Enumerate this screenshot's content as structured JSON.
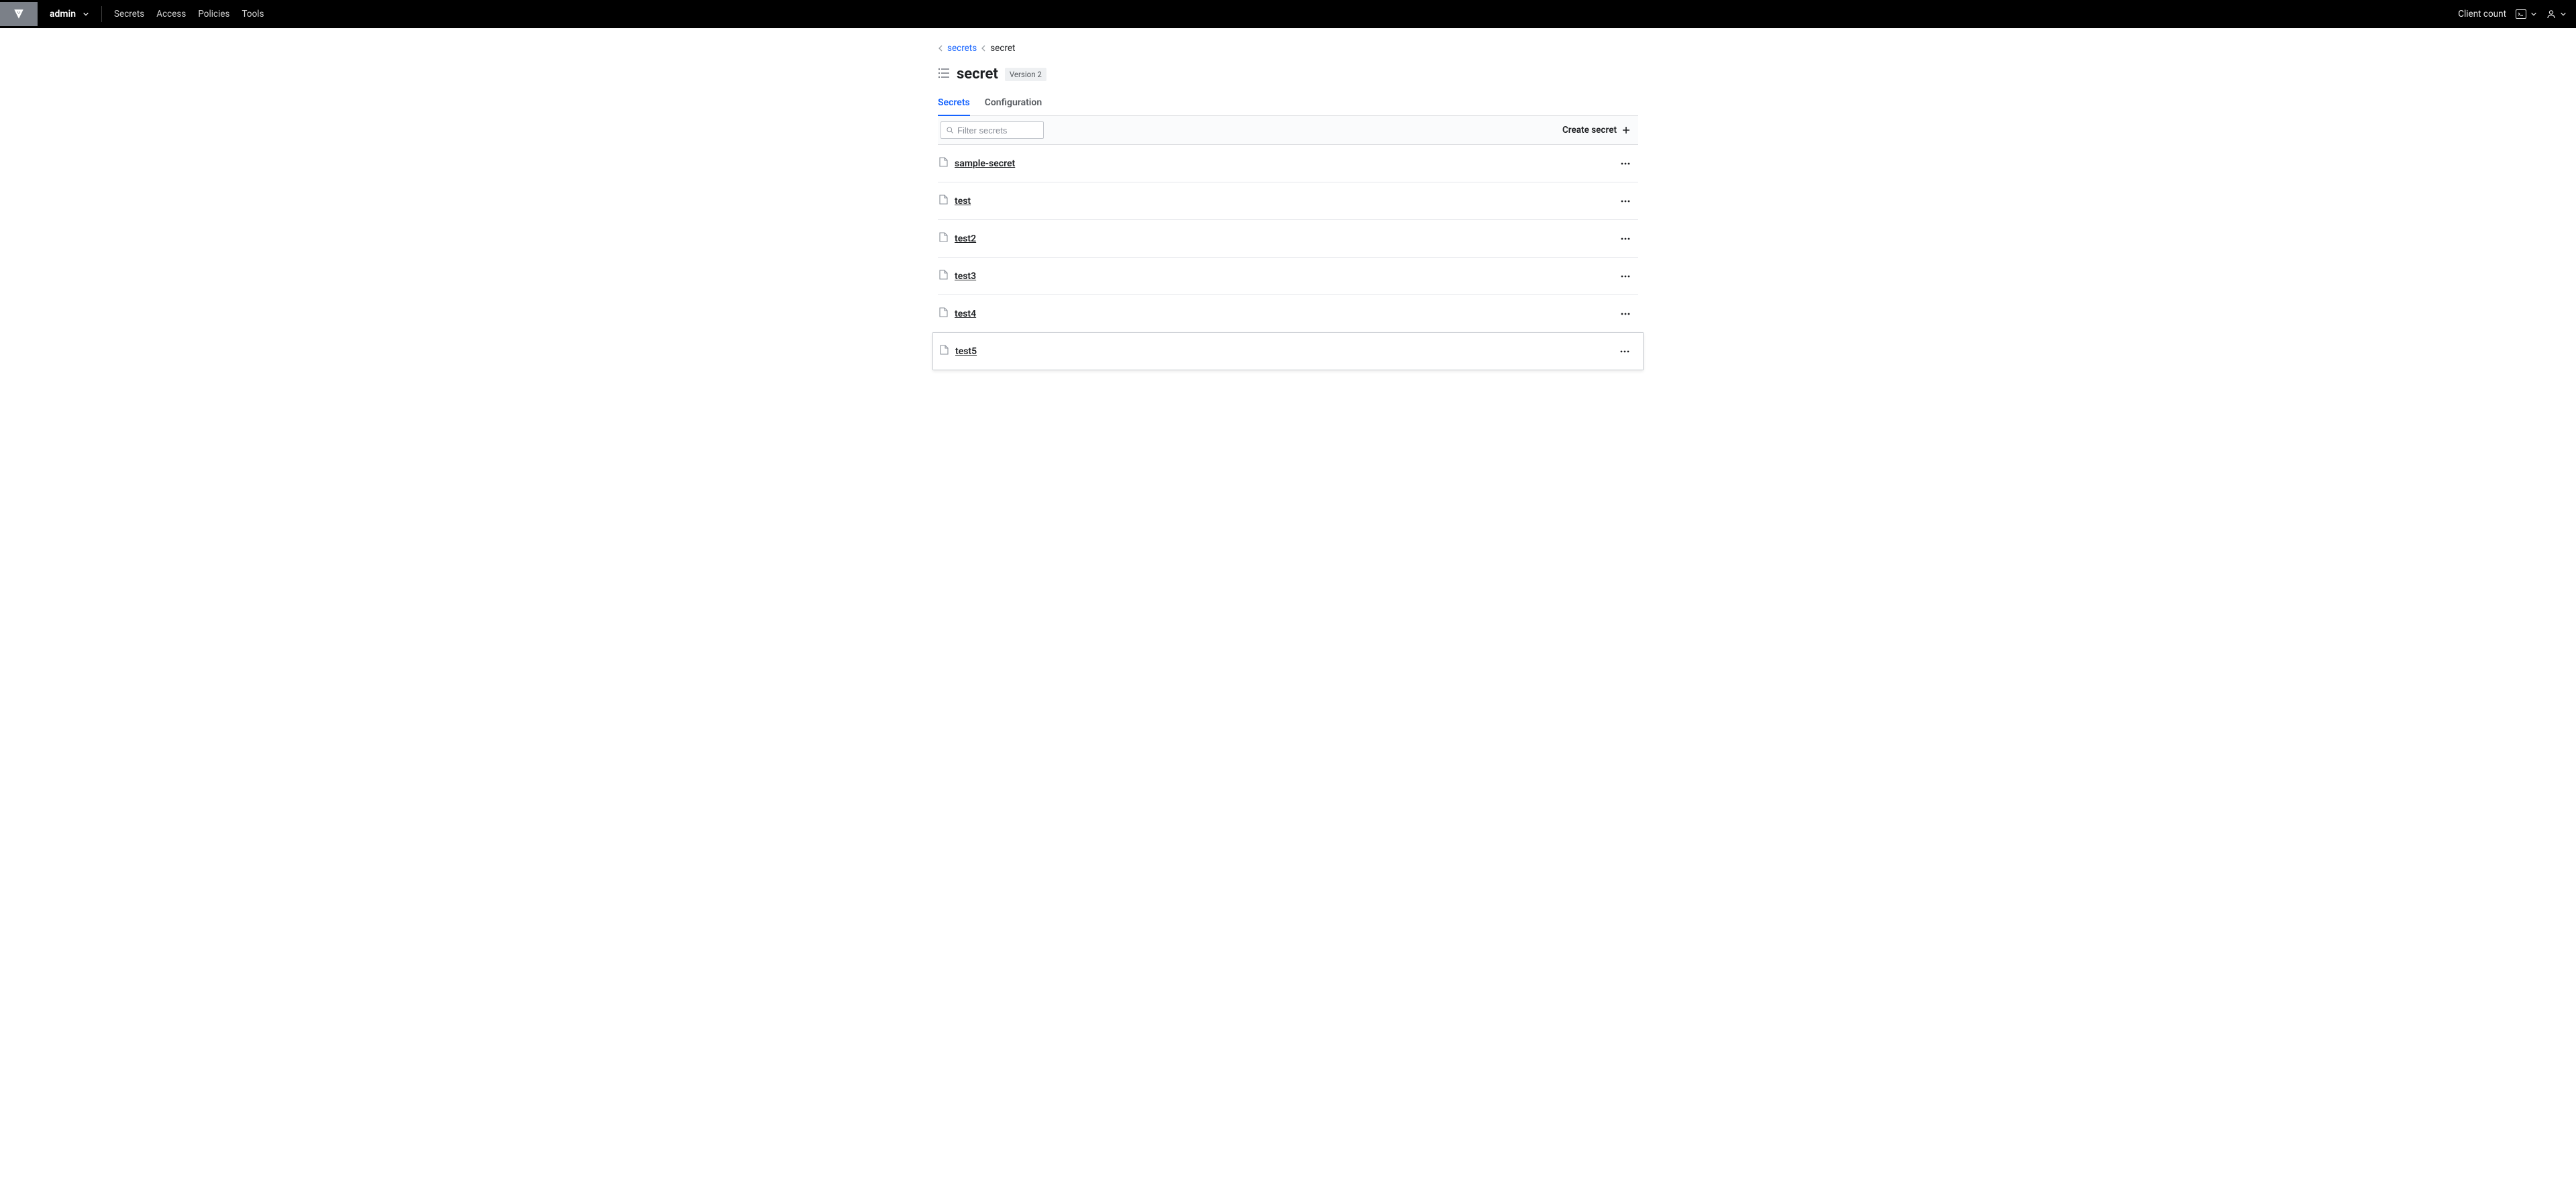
{
  "nav": {
    "namespace": "admin",
    "links": [
      "Secrets",
      "Access",
      "Policies",
      "Tools"
    ],
    "client_count": "Client count"
  },
  "breadcrumb": {
    "parent": "secrets",
    "current": "secret"
  },
  "page": {
    "title": "secret",
    "version_badge": "Version 2"
  },
  "tabs": [
    {
      "label": "Secrets",
      "active": true
    },
    {
      "label": "Configuration",
      "active": false
    }
  ],
  "toolbar": {
    "filter_placeholder": "Filter secrets",
    "create_label": "Create secret"
  },
  "secrets": [
    {
      "name": " sample-secret"
    },
    {
      "name": " test"
    },
    {
      "name": " test2"
    },
    {
      "name": " test3"
    },
    {
      "name": " test4"
    },
    {
      "name": " test5"
    }
  ]
}
